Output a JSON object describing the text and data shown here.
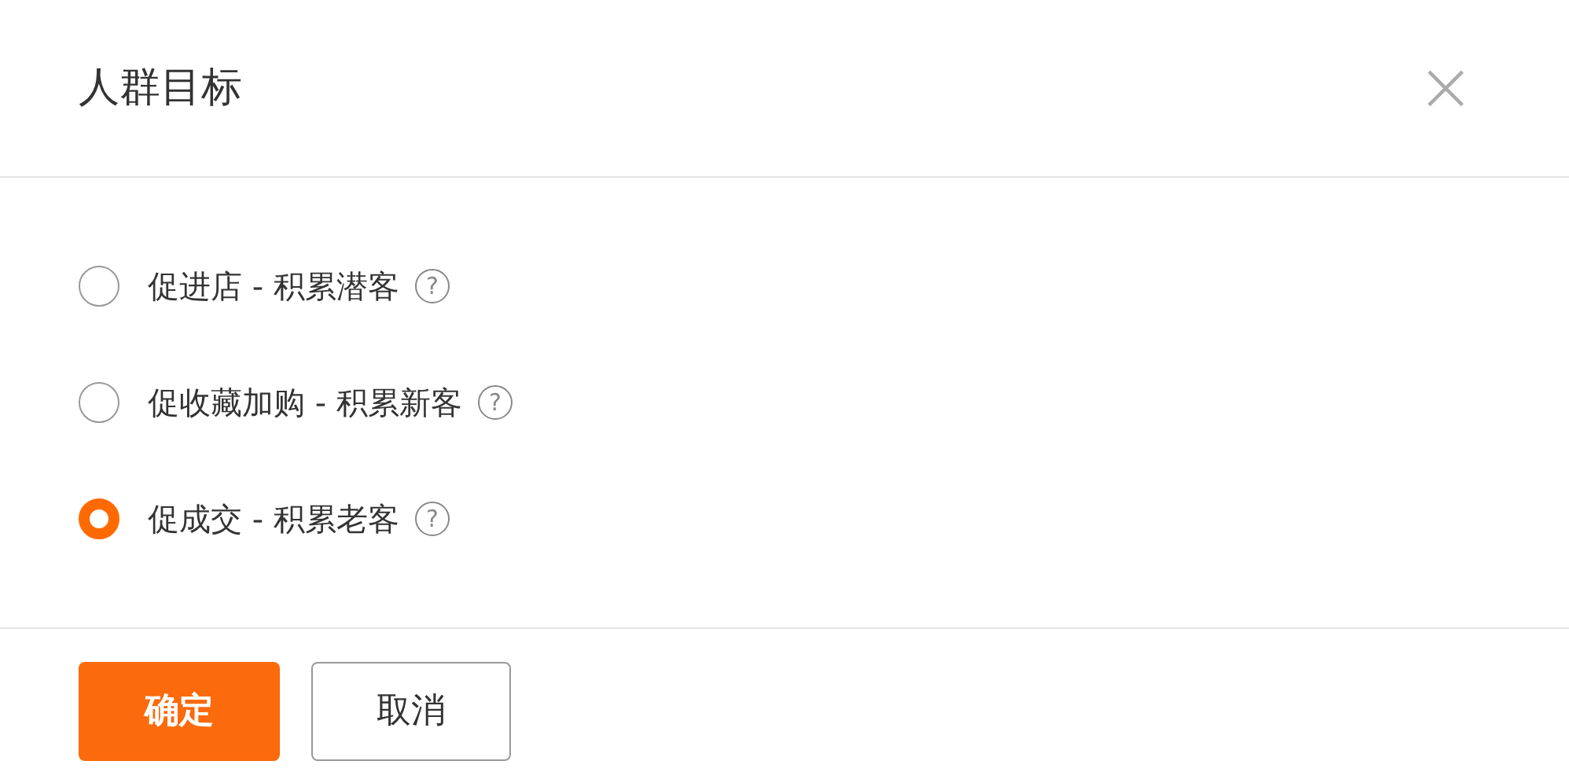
{
  "dialog": {
    "title": "人群目标",
    "close": "×"
  },
  "options": [
    {
      "label": "促进店 - 积累潜客",
      "selected": false,
      "help": "?"
    },
    {
      "label": "促收藏加购 - 积累新客",
      "selected": false,
      "help": "?"
    },
    {
      "label": "促成交 - 积累老客",
      "selected": true,
      "help": "?"
    }
  ],
  "buttons": [
    {
      "label": "确定",
      "kind": "primary"
    },
    {
      "label": "取消",
      "kind": "secondary"
    }
  ]
}
